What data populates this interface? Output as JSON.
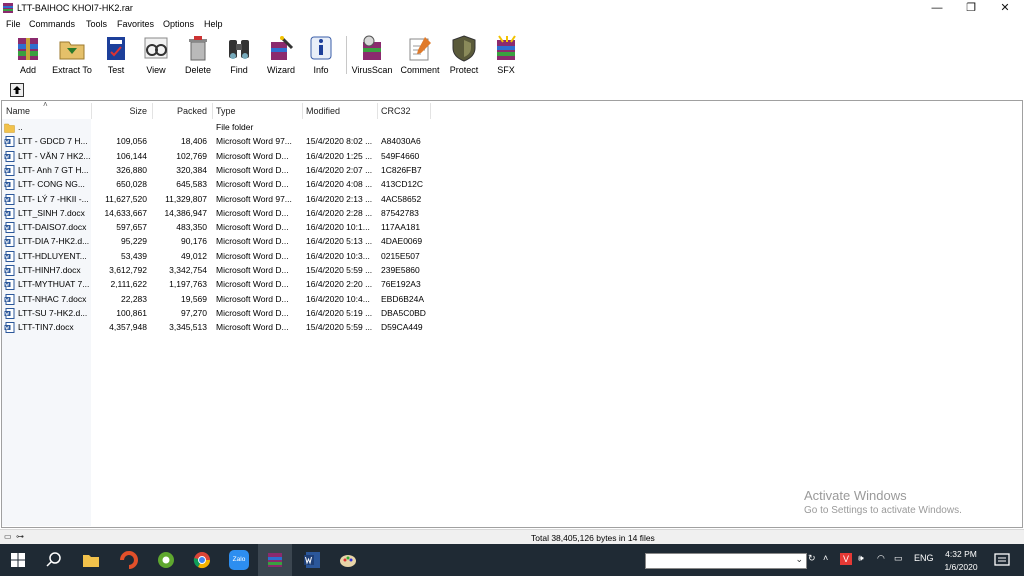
{
  "window": {
    "title": "LTT-BAIHOC KHOI7-HK2.rar",
    "controls": [
      "—",
      "❐",
      "✕"
    ]
  },
  "menu": [
    "File",
    "Commands",
    "Tools",
    "Favorites",
    "Options",
    "Help"
  ],
  "toolbar": [
    {
      "label": "Add",
      "icon": "add-archive-icon"
    },
    {
      "label": "Extract To",
      "icon": "extract-folder-icon"
    },
    {
      "label": "Test",
      "icon": "test-book-icon"
    },
    {
      "label": "View",
      "icon": "view-glasses-icon"
    },
    {
      "label": "Delete",
      "icon": "delete-trash-icon"
    },
    {
      "label": "Find",
      "icon": "find-binoculars-icon"
    },
    {
      "label": "Wizard",
      "icon": "wizard-wand-icon"
    },
    {
      "label": "Info",
      "icon": "info-icon"
    },
    {
      "label": "VirusScan",
      "icon": "virusscan-icon"
    },
    {
      "label": "Comment",
      "icon": "comment-pen-icon"
    },
    {
      "label": "Protect",
      "icon": "protect-shield-icon"
    },
    {
      "label": "SFX",
      "icon": "sfx-archive-icon"
    }
  ],
  "columns": {
    "name": "Name",
    "size": "Size",
    "packed": "Packed",
    "type": "Type",
    "modified": "Modified",
    "crc": "CRC32"
  },
  "files": [
    {
      "name": "..",
      "size": "",
      "packed": "",
      "type": "File folder",
      "modified": "",
      "crc": "",
      "kind": "folder"
    },
    {
      "name": "LTT - GDCD 7 H...",
      "size": "109,056",
      "packed": "18,406",
      "type": "Microsoft Word 97...",
      "modified": "15/4/2020 8:02 ...",
      "crc": "A84030A6",
      "kind": "doc"
    },
    {
      "name": "LTT - VĂN 7 HK2...",
      "size": "106,144",
      "packed": "102,769",
      "type": "Microsoft Word D...",
      "modified": "16/4/2020 1:25 ...",
      "crc": "549F4660",
      "kind": "doc"
    },
    {
      "name": "LTT- Anh 7 GT H...",
      "size": "326,880",
      "packed": "320,384",
      "type": "Microsoft Word D...",
      "modified": "16/4/2020 2:07 ...",
      "crc": "1C826FB7",
      "kind": "doc"
    },
    {
      "name": "LTT- CONG NG...",
      "size": "650,028",
      "packed": "645,583",
      "type": "Microsoft Word D...",
      "modified": "16/4/2020 4:08 ...",
      "crc": "413CD12C",
      "kind": "doc"
    },
    {
      "name": "LTT- LÝ 7 -HKII -...",
      "size": "11,627,520",
      "packed": "11,329,807",
      "type": "Microsoft Word 97...",
      "modified": "16/4/2020 2:13 ...",
      "crc": "4AC58652",
      "kind": "doc"
    },
    {
      "name": "LTT_SINH 7.docx",
      "size": "14,633,667",
      "packed": "14,386,947",
      "type": "Microsoft Word D...",
      "modified": "16/4/2020 2:28 ...",
      "crc": "87542783",
      "kind": "doc"
    },
    {
      "name": "LTT-DAISO7.docx",
      "size": "597,657",
      "packed": "483,350",
      "type": "Microsoft Word D...",
      "modified": "16/4/2020 10:1...",
      "crc": "117AA181",
      "kind": "doc"
    },
    {
      "name": "LTT-DIA 7-HK2.d...",
      "size": "95,229",
      "packed": "90,176",
      "type": "Microsoft Word D...",
      "modified": "16/4/2020 5:13 ...",
      "crc": "4DAE0069",
      "kind": "doc"
    },
    {
      "name": "LTT-HDLUYENT...",
      "size": "53,439",
      "packed": "49,012",
      "type": "Microsoft Word D...",
      "modified": "16/4/2020 10:3...",
      "crc": "0215E507",
      "kind": "doc"
    },
    {
      "name": "LTT-HINH7.docx",
      "size": "3,612,792",
      "packed": "3,342,754",
      "type": "Microsoft Word D...",
      "modified": "15/4/2020 5:59 ...",
      "crc": "239E5860",
      "kind": "doc"
    },
    {
      "name": "LTT-MYTHUAT 7...",
      "size": "2,111,622",
      "packed": "1,197,763",
      "type": "Microsoft Word D...",
      "modified": "16/4/2020 2:20 ...",
      "crc": "76E192A3",
      "kind": "doc"
    },
    {
      "name": "LTT-NHAC 7.docx",
      "size": "22,283",
      "packed": "19,569",
      "type": "Microsoft Word D...",
      "modified": "16/4/2020 10:4...",
      "crc": "EBD6B24A",
      "kind": "doc"
    },
    {
      "name": "LTT-SU 7-HK2.d...",
      "size": "100,861",
      "packed": "97,270",
      "type": "Microsoft Word D...",
      "modified": "16/4/2020 5:19 ...",
      "crc": "DBA5C0BD",
      "kind": "doc"
    },
    {
      "name": "LTT-TIN7.docx",
      "size": "4,357,948",
      "packed": "3,345,513",
      "type": "Microsoft Word D...",
      "modified": "15/4/2020 5:59 ...",
      "crc": "D59CA449",
      "kind": "doc"
    }
  ],
  "status": {
    "total": "Total 38,405,126 bytes in 14 files"
  },
  "watermark": {
    "line1": "Activate Windows",
    "line2": "Go to Settings to activate Windows."
  },
  "taskbar": {
    "apps": [
      "windows-start-icon",
      "search-icon",
      "file-explorer-icon",
      "ccleaner-icon",
      "coccoc-browser-icon",
      "chrome-icon",
      "zalo-icon",
      "winrar-icon",
      "word-icon",
      "paint-icon"
    ],
    "zalo_label": "Zalo",
    "lang": "ENG",
    "time": "4:32 PM",
    "date": "1/6/2020"
  }
}
